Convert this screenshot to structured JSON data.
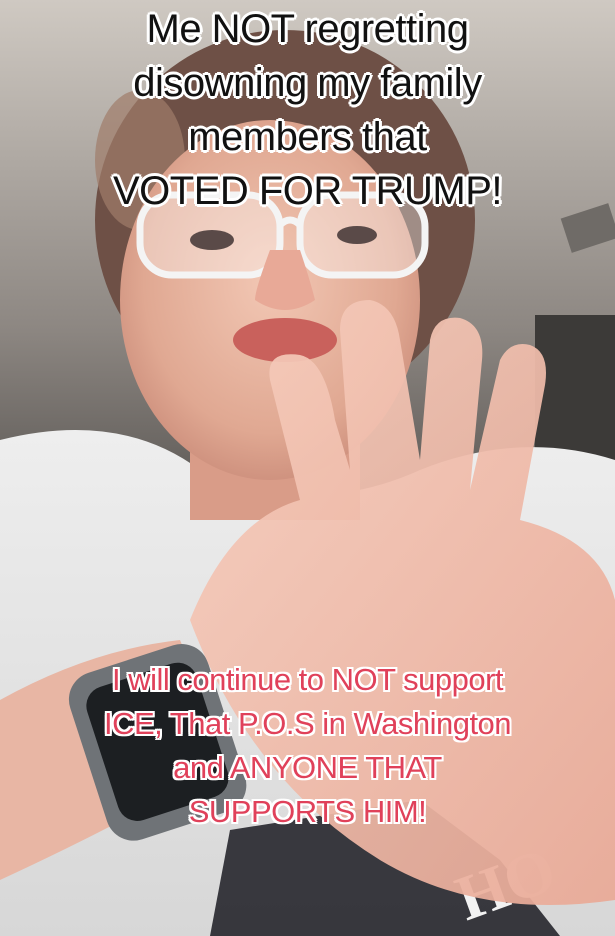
{
  "caption_top": {
    "lines": [
      "Me NOT regretting",
      "disowning my family",
      "members that",
      "VOTED FOR TRUMP!"
    ],
    "color": "#111111"
  },
  "caption_bottom": {
    "lines": [
      "I will continue to NOT support",
      "ICE, That P.O.S in Washington",
      "and ANYONE THAT",
      "SUPPORTS HIM!"
    ],
    "color": "#e0415a"
  },
  "shirt_print": "HO"
}
